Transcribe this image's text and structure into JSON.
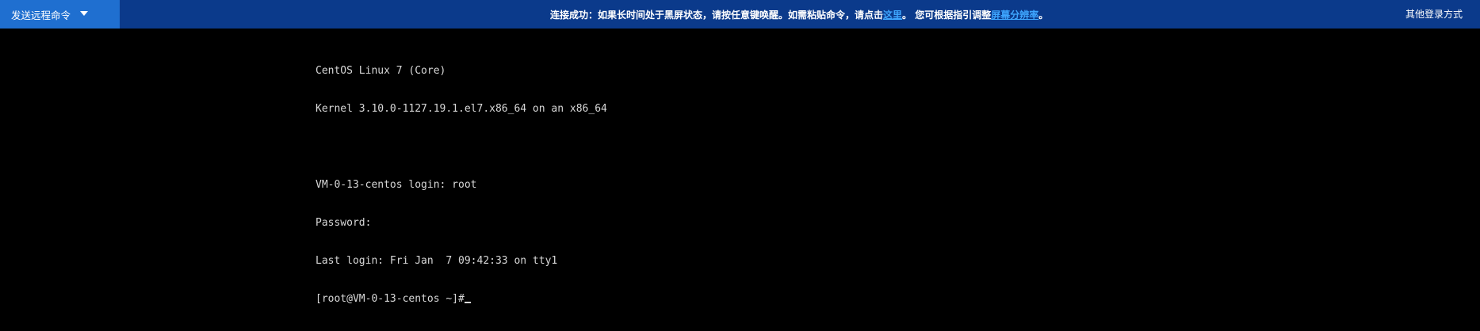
{
  "toolbar": {
    "send_command_label": "发送远程命令",
    "notice_prefix": "连接成功：如果长时间处于黑屏状态，请按任意键唤醒。如需粘贴命令，请点击",
    "notice_link_here": "这里",
    "notice_middle": "。 您可根据指引调整",
    "notice_link_resolution": "屏幕分辨率",
    "notice_suffix": "。",
    "other_login_label": "其他登录方式"
  },
  "terminal": {
    "lines": [
      "CentOS Linux 7 (Core)",
      "Kernel 3.10.0-1127.19.1.el7.x86_64 on an x86_64",
      "",
      "VM-0-13-centos login: root",
      "Password:",
      "Last login: Fri Jan  7 09:42:33 on tty1",
      "[root@VM-0-13-centos ~]#"
    ]
  },
  "colors": {
    "topbar_bg": "#0b3a8b",
    "send_button_bg": "#1f6fd0",
    "link": "#3ea6ff",
    "terminal_bg": "#000000",
    "terminal_text": "#d8d8d8"
  },
  "icons": {
    "send_command_dropdown": "caret-down-icon"
  }
}
